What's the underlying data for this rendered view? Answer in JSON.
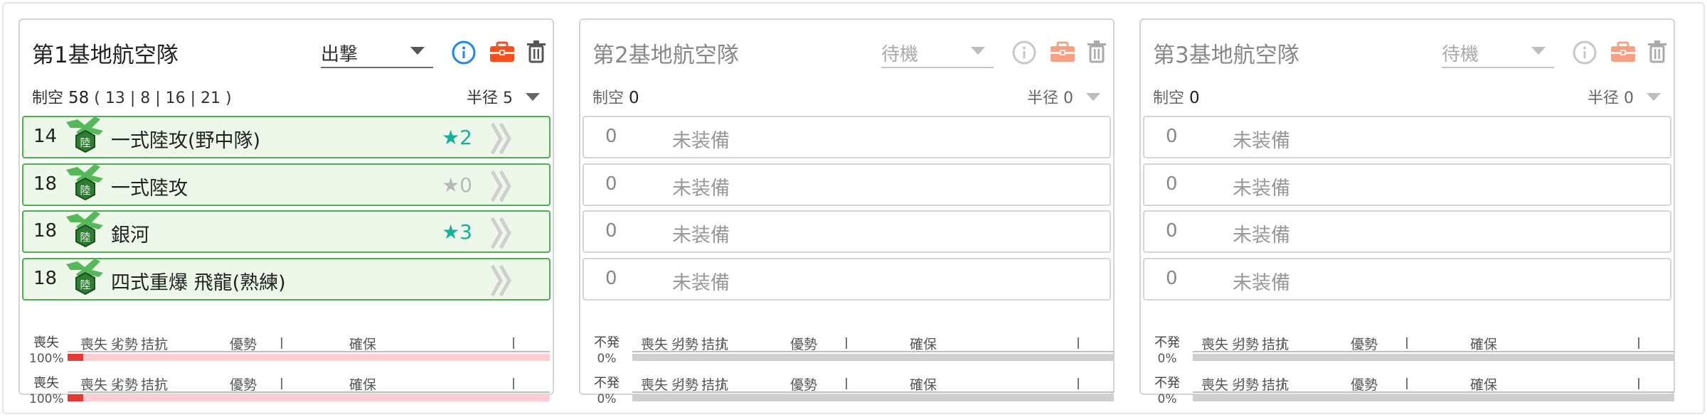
{
  "colors": {
    "accent": "#1e88e5",
    "brief": "#f4511e",
    "brief_off": "#f6a084",
    "green": "#4caf50",
    "star_on": "#14b19c",
    "star_off": "#b9b9b9",
    "loss_bar": "#e53935",
    "loss_bg": "#ffcdd2",
    "neutral_bar": "#cfcfcf"
  },
  "panels": [
    {
      "title": "第1基地航空隊",
      "mode": "出撃",
      "air_label": "制空",
      "air_value": "58",
      "air_detail": "( 13 | 8 | 16 | 21 )",
      "radius_label": "半径",
      "radius_value": "5",
      "icons": [
        "info-icon",
        "briefcase-icon",
        "trash-icon"
      ],
      "slots": [
        {
          "count": "14",
          "name": "一式陸攻(野中隊)",
          "star": "★",
          "level": "2",
          "starred": true
        },
        {
          "count": "18",
          "name": "一式陸攻",
          "star": "★",
          "level": "0",
          "starred": false
        },
        {
          "count": "18",
          "name": "銀河",
          "star": "★",
          "level": "3",
          "starred": true
        },
        {
          "count": "18",
          "name": "四式重爆 飛龍(熟練)",
          "star": "★",
          "level": "",
          "starred": false
        }
      ],
      "bars": [
        {
          "status": "喪失",
          "percent": "100%",
          "segments": [
            "喪失",
            "劣勢",
            "拮抗",
            "優勢",
            "確保"
          ],
          "ratio": 1.0
        },
        {
          "status": "喪失",
          "percent": "100%",
          "segments": [
            "喪失",
            "劣勢",
            "拮抗",
            "優勢",
            "確保"
          ],
          "ratio": 1.0
        }
      ]
    },
    {
      "title": "第2基地航空隊",
      "mode": "待機",
      "air_label": "制空",
      "air_value": "0",
      "air_detail": "",
      "radius_label": "半径",
      "radius_value": "0",
      "icons": [
        "info-icon",
        "briefcase-icon",
        "trash-icon"
      ],
      "slots": [
        {
          "count": "0",
          "name": "未装備"
        },
        {
          "count": "0",
          "name": "未装備"
        },
        {
          "count": "0",
          "name": "未装備"
        },
        {
          "count": "0",
          "name": "未装備"
        }
      ],
      "bars": [
        {
          "status": "不発",
          "percent": "0%",
          "segments": [
            "喪失",
            "劣勢",
            "拮抗",
            "優勢",
            "確保"
          ],
          "ratio": 0.0
        },
        {
          "status": "不発",
          "percent": "0%",
          "segments": [
            "喪失",
            "劣勢",
            "拮抗",
            "優勢",
            "確保"
          ],
          "ratio": 0.0
        }
      ]
    },
    {
      "title": "第3基地航空隊",
      "mode": "待機",
      "air_label": "制空",
      "air_value": "0",
      "air_detail": "",
      "radius_label": "半径",
      "radius_value": "0",
      "icons": [
        "info-icon",
        "briefcase-icon",
        "trash-icon"
      ],
      "slots": [
        {
          "count": "0",
          "name": "未装備"
        },
        {
          "count": "0",
          "name": "未装備"
        },
        {
          "count": "0",
          "name": "未装備"
        },
        {
          "count": "0",
          "name": "未装備"
        }
      ],
      "bars": [
        {
          "status": "不発",
          "percent": "0%",
          "segments": [
            "喪失",
            "劣勢",
            "拮抗",
            "優勢",
            "確保"
          ],
          "ratio": 0.0
        },
        {
          "status": "不発",
          "percent": "0%",
          "segments": [
            "喪失",
            "劣勢",
            "拮抗",
            "優勢",
            "確保"
          ],
          "ratio": 0.0
        }
      ]
    }
  ]
}
